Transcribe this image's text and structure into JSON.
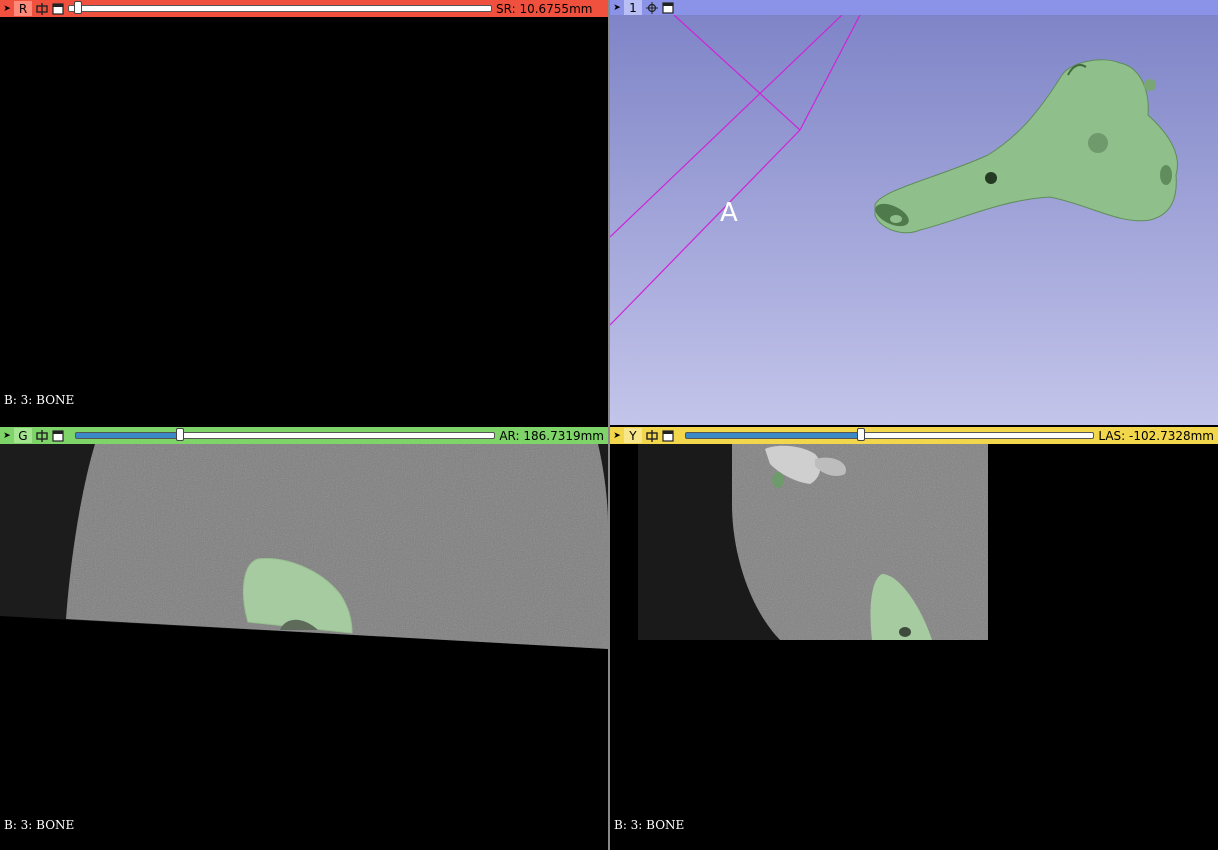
{
  "red": {
    "label": "R",
    "offset": "SR: 10.6755mm",
    "slider_fraction": 0.02,
    "corner_text": "B: 3: BONE",
    "colors": {
      "bar": "#f0513f",
      "label_bg": "#ff8a7a",
      "track": "#ffffff"
    }
  },
  "threed": {
    "label": "1",
    "axis_letter": "A",
    "colors": {
      "bar": "#8a93e8",
      "label_bg": "#b9bff5",
      "bg_top": "#7c82c6",
      "bg_bottom": "#c3c5ea",
      "box": "#d023d6",
      "bone": "#8fbf8a"
    }
  },
  "green": {
    "label": "G",
    "offset": "AR: 186.7319mm",
    "slider_fraction": 0.25,
    "corner_text": "B: 3: BONE",
    "colors": {
      "bar": "#7ed468",
      "label_bg": "#a4e58f",
      "track_fill": "#3b88c7"
    }
  },
  "yellow": {
    "label": "Y",
    "offset": "LAS: -102.7328mm",
    "slider_fraction": 0.43,
    "corner_text": "B: 3: BONE",
    "colors": {
      "bar": "#f2d64b",
      "label_bg": "#f7e68a",
      "track_fill": "#3b88c7"
    }
  }
}
